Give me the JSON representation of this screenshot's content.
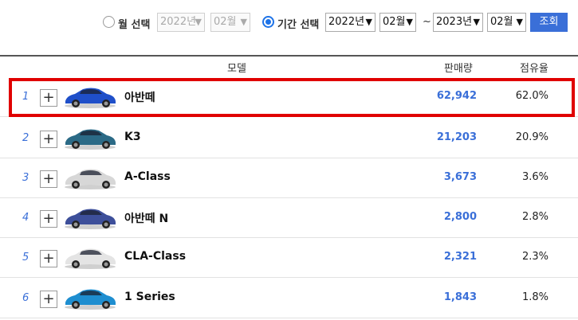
{
  "filter": {
    "month_mode_label": "월 선택",
    "month_year": "2022년",
    "month_month": "02월",
    "period_mode_label": "기간 선택",
    "from_year": "2022년",
    "from_month": "02월",
    "separator": "~",
    "to_year": "2023년",
    "to_month": "02월",
    "search_label": "조회"
  },
  "table": {
    "headers": {
      "model": "모델",
      "sales": "판매량",
      "share": "점유율"
    },
    "rows": [
      {
        "rank": "1",
        "model": "아반떼",
        "sales": "62,942",
        "share": "62.0%",
        "car_color": "#1f4fc9"
      },
      {
        "rank": "2",
        "model": "K3",
        "sales": "21,203",
        "share": "20.9%",
        "car_color": "#2b6a86"
      },
      {
        "rank": "3",
        "model": "A-Class",
        "sales": "3,673",
        "share": "3.6%",
        "car_color": "#d7d7d7"
      },
      {
        "rank": "4",
        "model": "아반떼 N",
        "sales": "2,800",
        "share": "2.8%",
        "car_color": "#3d4f9a"
      },
      {
        "rank": "5",
        "model": "CLA-Class",
        "sales": "2,321",
        "share": "2.3%",
        "car_color": "#e4e4e4"
      },
      {
        "rank": "6",
        "model": "1 Series",
        "sales": "1,843",
        "share": "1.8%",
        "car_color": "#1e8ed0"
      }
    ]
  },
  "colors": {
    "accent": "#3a6fd8",
    "highlight": "#e00000"
  }
}
